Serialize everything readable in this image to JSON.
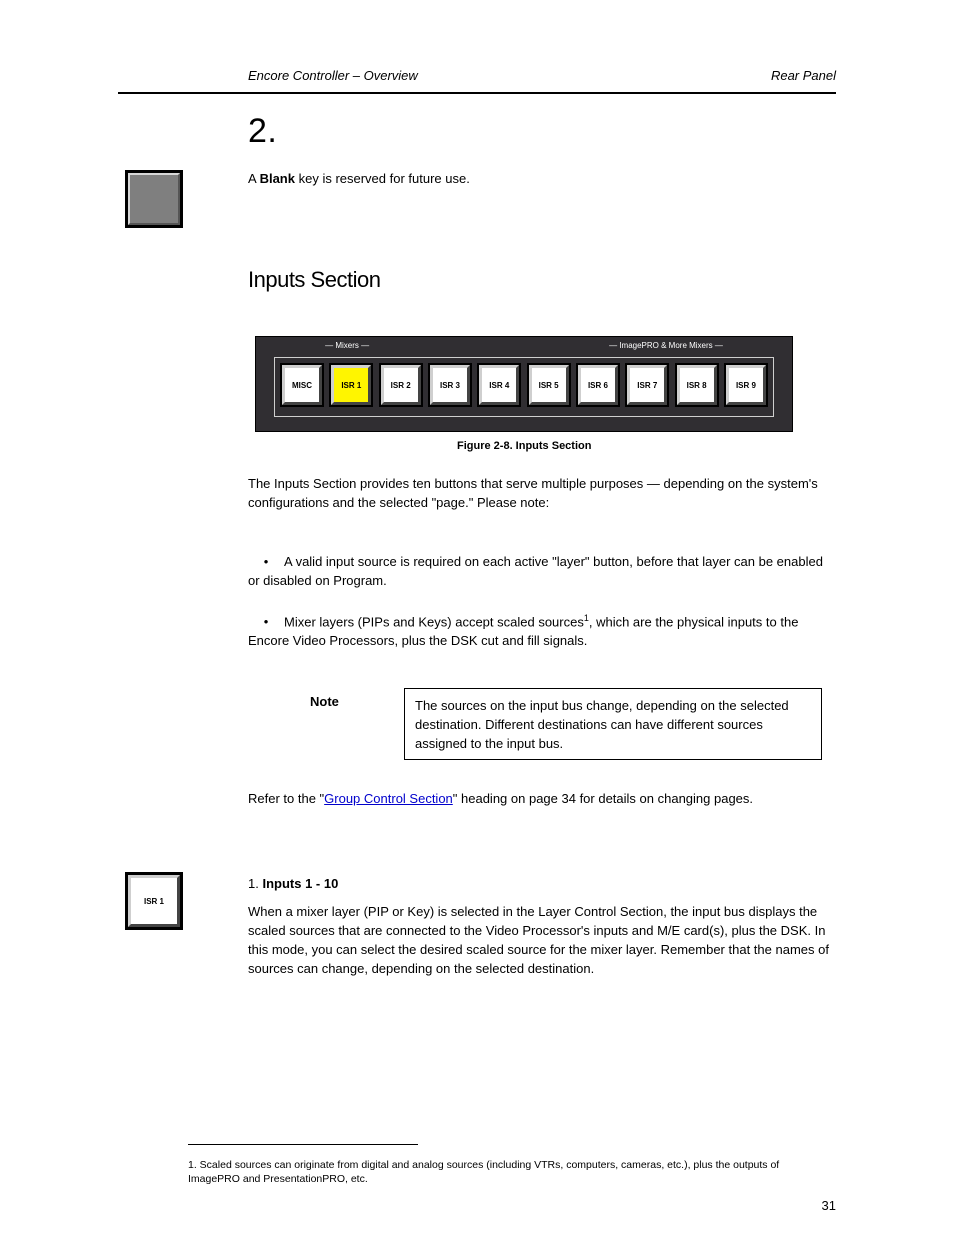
{
  "header": {
    "left": "Encore Controller – Overview",
    "right": "Rear Panel"
  },
  "page_title": "2.",
  "big_button": {
    "label": "Blank Key",
    "text_before": "A ",
    "text_key": "Blank",
    "text_after": " key is reserved for future use."
  },
  "section_title": "Inputs Section",
  "inputs_panel": {
    "group_label_left": "— Mixers —",
    "group_label_right": "— ImagePRO & More Mixers —",
    "buttons": [
      {
        "label": "MISC",
        "color": "white"
      },
      {
        "label": "ISR 1",
        "color": "yellow"
      },
      {
        "label": "ISR 2",
        "color": "white"
      },
      {
        "label": "ISR 3",
        "color": "white"
      },
      {
        "label": "ISR 4",
        "color": "white"
      },
      {
        "label": "ISR 5",
        "color": "white"
      },
      {
        "label": "ISR 6",
        "color": "white"
      },
      {
        "label": "ISR 7",
        "color": "white"
      },
      {
        "label": "ISR 8",
        "color": "white"
      },
      {
        "label": "ISR 9",
        "color": "white"
      }
    ]
  },
  "figure_caption": "Figure 2-8. Inputs Section",
  "para1": "The Inputs Section provides ten buttons that serve multiple purposes — depending on the system's configurations and the selected \"page.\" Please note:",
  "bullets": {
    "b1": "A valid input source is required on each active \"layer\" button, before that layer can be enabled or disabled on Program.",
    "b2_before": "Mixer layers (PIPs and Keys) accept scaled sources",
    "b2_sup": "1",
    "b2_after": ", which are the physical inputs to the Encore Video Processors, plus the DSK cut and fill signals."
  },
  "note_label": "Note",
  "note_text": "The sources on the input bus change, depending on the selected destination. Different destinations can have different sources assigned to the input bus.",
  "para4_before": "Refer to the \"",
  "para4_link": "Group Control Section",
  "para4_after": "\" heading on page 34 for details on changing pages.",
  "inputs1": {
    "title_before": "1. ",
    "title_bold": "Inputs 1 - 10",
    "body": "When a mixer layer (PIP or Key) is selected in the Layer Control Section, the input bus displays the scaled sources that are connected to the Video Processor's inputs and M/E card(s), plus the DSK. In this mode, you can select the desired scaled source for the mixer layer. Remember that the names of sources can change, depending on the selected destination."
  },
  "footnote": {
    "num": "1.",
    "text": " Scaled sources can originate from digital and analog sources (including VTRs, computers, cameras, etc.), plus the outputs of ImagePRO and PresentationPRO, etc."
  },
  "page_number": "31"
}
